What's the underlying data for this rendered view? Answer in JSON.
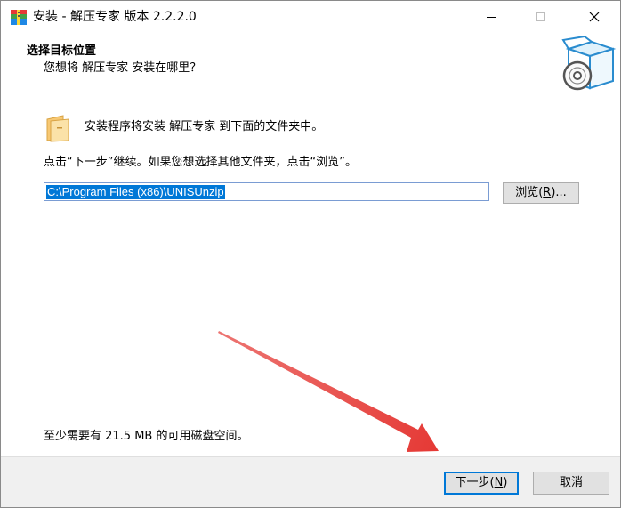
{
  "window": {
    "title": "安装 - 解压专家 版本 2.2.2.0",
    "app_icon": "zip-archive-icon",
    "controls": [
      "minimize-icon",
      "maximize-icon",
      "close-icon"
    ]
  },
  "header": {
    "title": "选择目标位置",
    "subtitle": "您想将 解压专家 安装在哪里？",
    "icon": "install-box-disc-icon"
  },
  "body": {
    "folder_icon": "folder-icon",
    "intro": "安装程序将安装 解压专家 到下面的文件夹中。",
    "instruction": "点击“下一步”继续。如果您想选择其他文件夹，点击“浏览”。",
    "path_value": "C:\\Program Files (x86)\\UNISUnzip",
    "browse": {
      "text": "浏览(",
      "key": "R",
      "suffix": ")..."
    },
    "space_required": "至少需要有 21.5 MB 的可用磁盘空间。"
  },
  "footer": {
    "next": {
      "text": "下一步(",
      "key": "N",
      "suffix": ")"
    },
    "cancel": "取消"
  },
  "colors": {
    "selection": "#0078d7",
    "annotation_arrow": "#e53935",
    "footer_bg": "#f0f0f0",
    "button_bg": "#e1e1e1"
  }
}
